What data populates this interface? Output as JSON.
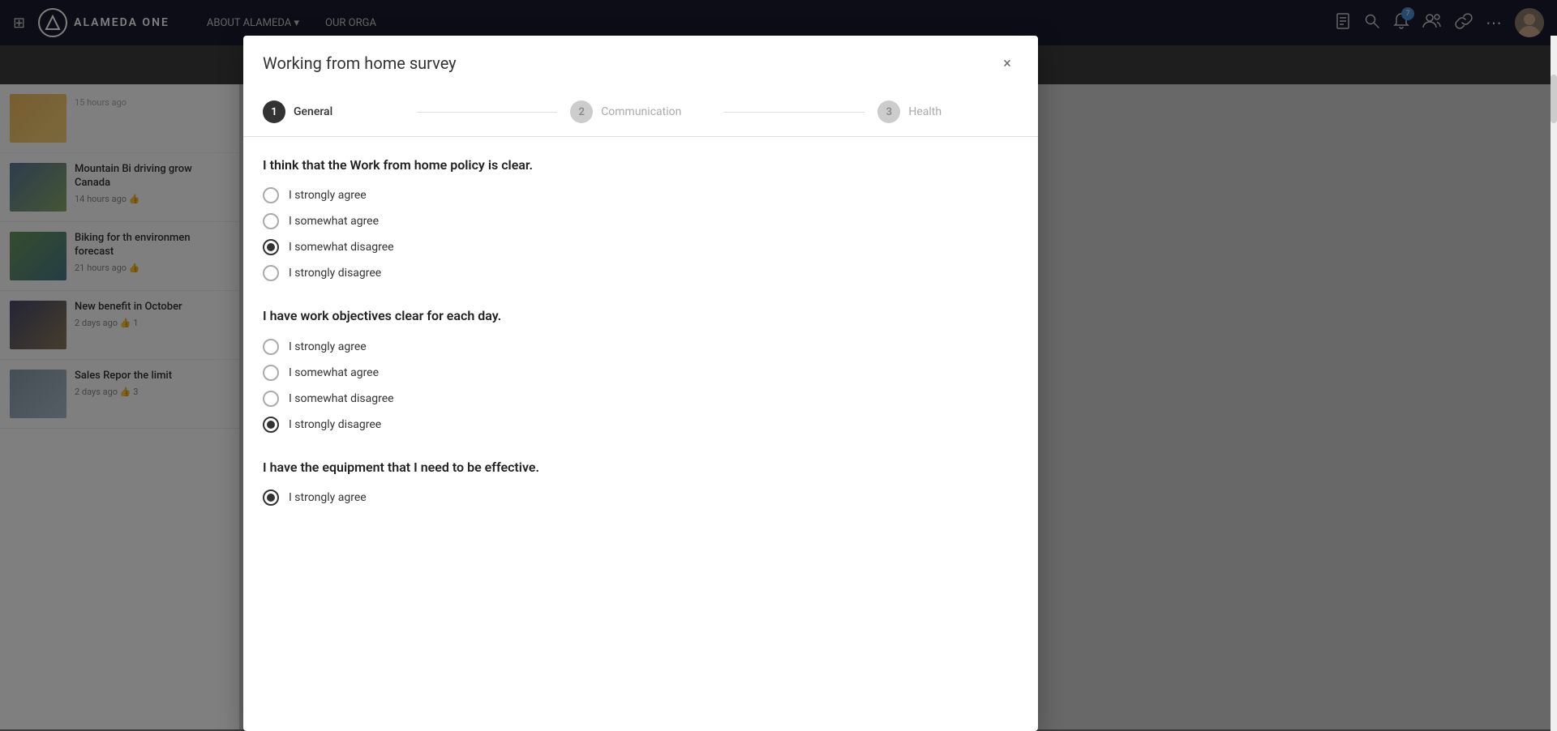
{
  "app": {
    "name": "ALAMEDA ONE",
    "logo_letter": "A"
  },
  "topbar": {
    "grid_icon": "⊞",
    "nav_items": [
      {
        "label": "ABOUT ALAMEDA",
        "has_dropdown": true
      },
      {
        "label": "OUR ORGA",
        "has_dropdown": false
      }
    ],
    "notification_count": "7",
    "icons": [
      "📄",
      "🔍",
      "🔔",
      "👥",
      "🔗",
      "⋯"
    ]
  },
  "news": {
    "items": [
      {
        "thumb_class": "mountain",
        "title": "Mountain Bi driving grow Canada",
        "time": "14 hours ago",
        "likes": ""
      },
      {
        "thumb_class": "biking",
        "title": "Biking for th environmen forecast",
        "time": "21 hours ago",
        "likes": ""
      },
      {
        "thumb_class": "benefits",
        "title": "New benefit in October",
        "time": "2 days ago",
        "likes": "1"
      },
      {
        "thumb_class": "sales",
        "title": "Sales Repor the limit",
        "time": "2 days ago",
        "likes": "3"
      }
    ]
  },
  "modal": {
    "title": "Working from home survey",
    "close_icon": "×",
    "steps": [
      {
        "number": "1",
        "label": "General",
        "state": "active"
      },
      {
        "number": "2",
        "label": "Communication",
        "state": "inactive"
      },
      {
        "number": "3",
        "label": "Health",
        "state": "inactive"
      }
    ],
    "questions": [
      {
        "id": "q1",
        "text": "I think that the Work from home policy is clear.",
        "options": [
          {
            "label": "I strongly agree",
            "selected": false
          },
          {
            "label": "I somewhat agree",
            "selected": false
          },
          {
            "label": "I somewhat disagree",
            "selected": true
          },
          {
            "label": "I strongly disagree",
            "selected": false
          }
        ]
      },
      {
        "id": "q2",
        "text": "I have work objectives clear for each day.",
        "options": [
          {
            "label": "I strongly agree",
            "selected": false
          },
          {
            "label": "I somewhat agree",
            "selected": false
          },
          {
            "label": "I somewhat disagree",
            "selected": false
          },
          {
            "label": "I strongly disagree",
            "selected": true
          }
        ]
      },
      {
        "id": "q3",
        "text": "I have the equipment that I need to be effective.",
        "options": [
          {
            "label": "I strongly agree",
            "selected": true
          }
        ]
      }
    ]
  }
}
